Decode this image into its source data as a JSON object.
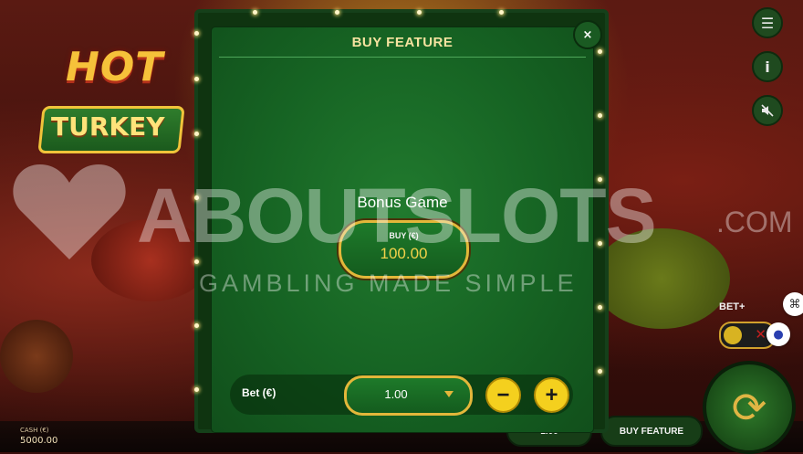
{
  "game": {
    "logo_line1": "HOT",
    "logo_line2": "TURKEY",
    "cash_label": "CASH (€)",
    "cash_value": "5000.00",
    "bottom_center_value": "1.00",
    "bottom_buy_feature": "BUY FEATURE",
    "bet_plus_label": "BET+"
  },
  "side_buttons": {
    "menu_icon": "menu-icon",
    "info_icon": "info-icon",
    "sound_icon": "sound-off-icon"
  },
  "modal": {
    "title": "BUY FEATURE",
    "close_glyph": "×",
    "feature_name": "Bonus Game",
    "buy_label": "BUY (€)",
    "buy_price": "100.00",
    "bet_label": "Bet (€)",
    "bet_value": "1.00",
    "minus_glyph": "−",
    "plus_glyph": "+"
  },
  "watermark": {
    "brand": "ABOUTSLOTS",
    "suffix": ".COM",
    "tagline": "GAMBLING MADE SIMPLE"
  },
  "colors": {
    "modal_green": "#166323",
    "gold_border": "#e3b73a",
    "price_yellow": "#f3d24a",
    "round_button": "#f4d01e"
  }
}
